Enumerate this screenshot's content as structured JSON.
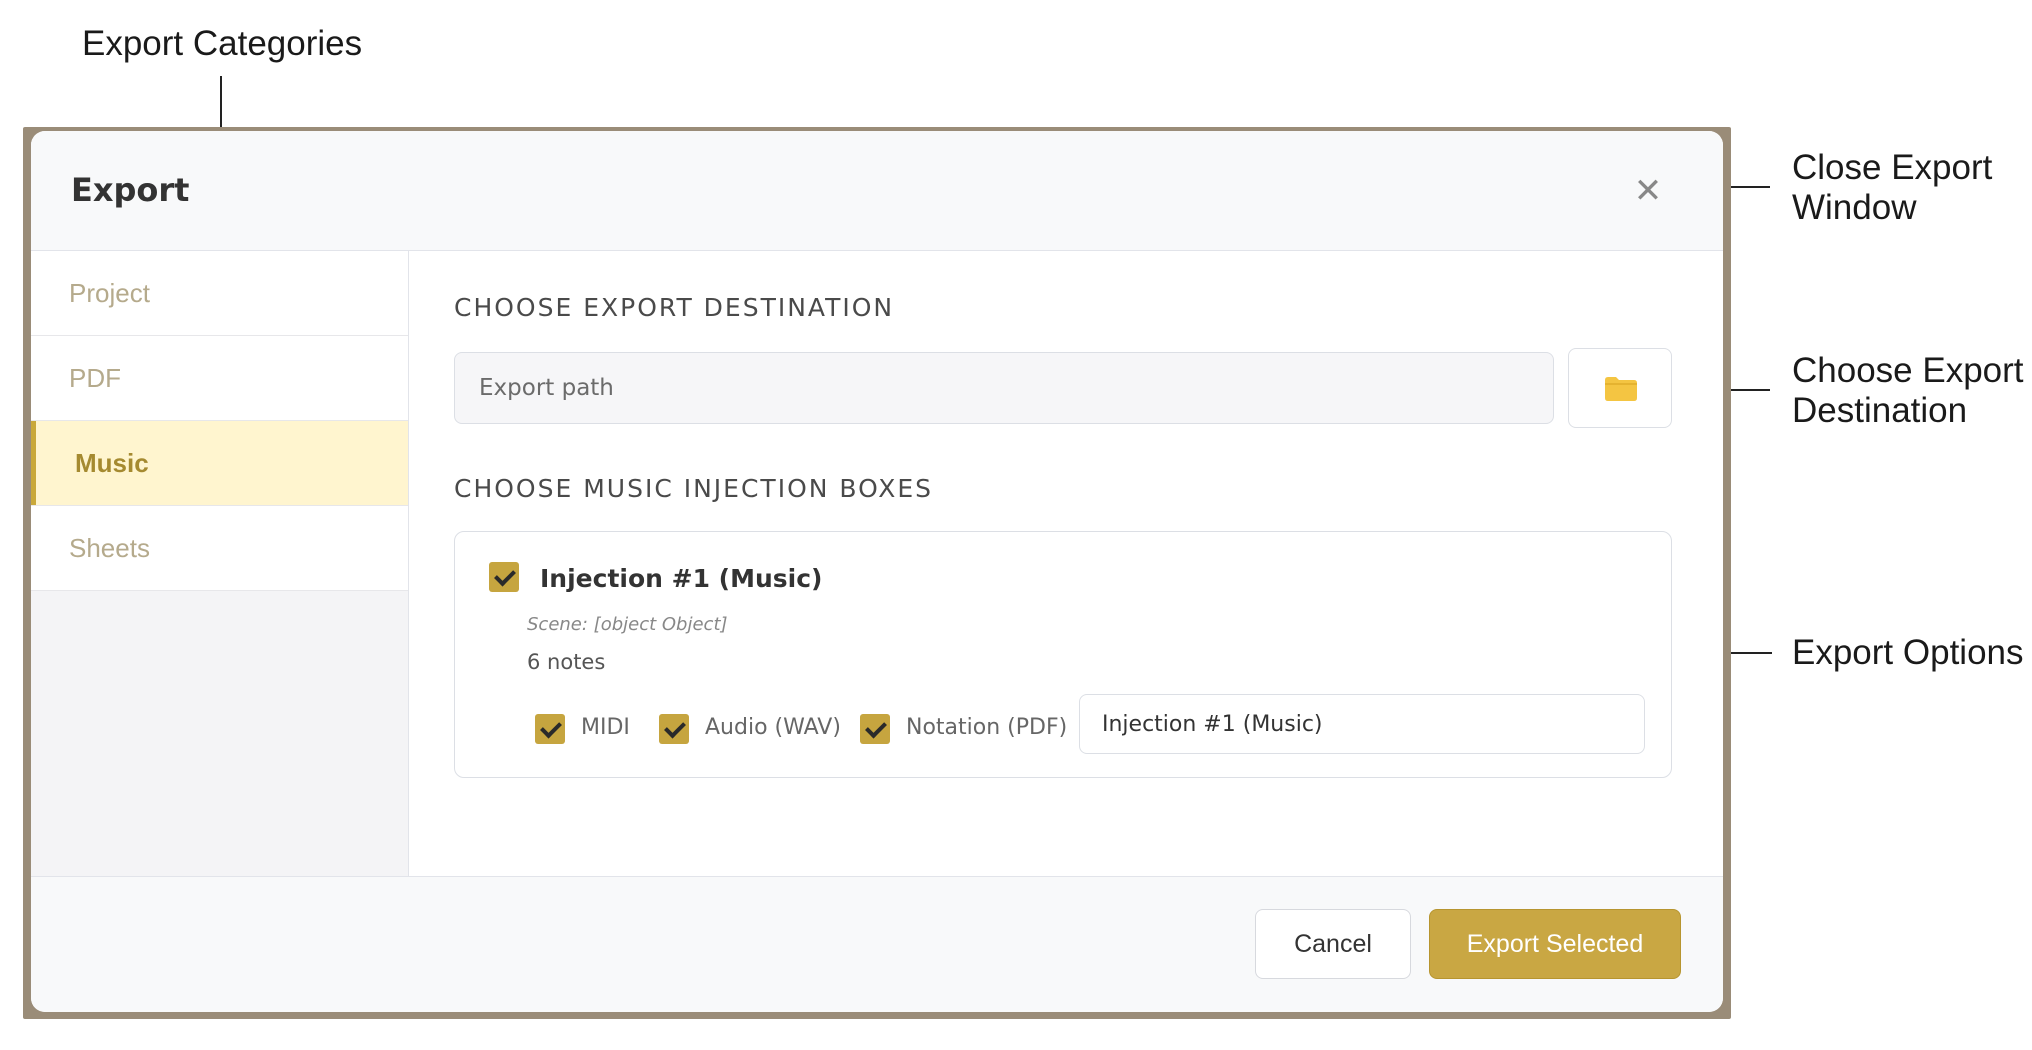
{
  "annotations": {
    "export_categories": "Export Categories",
    "close_window_line1": "Close Export",
    "close_window_line2": "Window",
    "choose_destination_line1": "Choose Export",
    "choose_destination_line2": "Destination",
    "export_options": "Export Options"
  },
  "dialog": {
    "title": "Export",
    "close_glyph": "✕"
  },
  "sidebar": {
    "items": [
      {
        "label": "Project"
      },
      {
        "label": "PDF"
      },
      {
        "label": "Music",
        "active": true
      },
      {
        "label": "Sheets"
      }
    ]
  },
  "destination": {
    "heading": "CHOOSE EXPORT DESTINATION",
    "placeholder": "Export path",
    "value": ""
  },
  "injection": {
    "heading": "CHOOSE MUSIC INJECTION BOXES",
    "items": [
      {
        "title": "Injection #1 (Music)",
        "scene": "Scene: [object Object]",
        "notes": "6 notes",
        "checked": true,
        "options": [
          {
            "label": "MIDI",
            "checked": true
          },
          {
            "label": "Audio (WAV)",
            "checked": true
          },
          {
            "label": "Notation (PDF)",
            "checked": true
          }
        ],
        "filename": "Injection #1 (Music)"
      }
    ]
  },
  "footer": {
    "cancel_label": "Cancel",
    "export_label": "Export Selected"
  },
  "colors": {
    "accent": "#c9a743",
    "active_bg": "#fff5cf",
    "frame": "#9a8c78",
    "folder": "#f4c542"
  }
}
